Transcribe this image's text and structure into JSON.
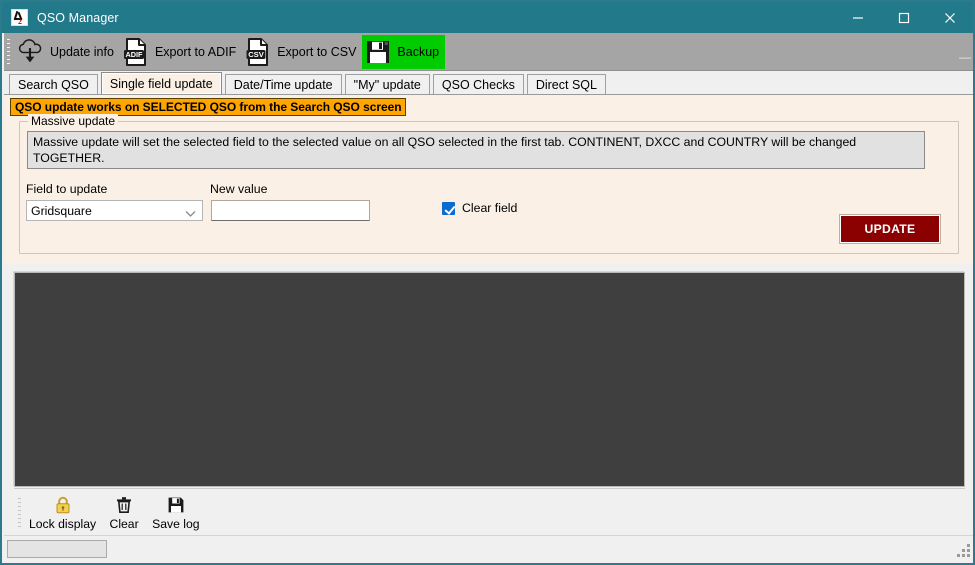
{
  "window": {
    "title": "QSO Manager",
    "app_icon": "qso-manager-icon",
    "controls": {
      "minimize": "minimize-icon",
      "maximize": "maximize-icon",
      "close": "close-icon"
    },
    "titlebar_color": "#21798a"
  },
  "toolbar": {
    "overflow_label": "—",
    "items": [
      {
        "label": "Update info",
        "icon": "cloud-download-icon",
        "highlight": false
      },
      {
        "label": "Export to ADIF",
        "icon": "file-adif-icon",
        "highlight": false
      },
      {
        "label": "Export to CSV",
        "icon": "file-csv-icon",
        "highlight": false
      },
      {
        "label": "Backup",
        "icon": "floppy-disk-icon",
        "highlight": true,
        "highlight_color": "#00cc00"
      }
    ]
  },
  "tabs": [
    {
      "label": "Search QSO",
      "selected": false
    },
    {
      "label": "Single field update",
      "selected": true
    },
    {
      "label": "Date/Time update",
      "selected": false
    },
    {
      "label": "\"My\" update",
      "selected": false
    },
    {
      "label": "QSO Checks",
      "selected": false
    },
    {
      "label": "Direct SQL",
      "selected": false
    }
  ],
  "page": {
    "banner": {
      "text": "QSO update works on SELECTED QSO from the Search QSO screen",
      "background": "#ffa500",
      "text_color": "#000000"
    },
    "group": {
      "legend": "Massive update",
      "description": "Massive update will set the selected field to the selected value on all QSO selected in the first tab. CONTINENT, DXCC and COUNTRY will be changed TOGETHER."
    },
    "field_to_update": {
      "label": "Field to update",
      "value": "Gridsquare",
      "chevron": "chevron-down-icon"
    },
    "new_value": {
      "label": "New value",
      "value": "",
      "placeholder": ""
    },
    "clear_field": {
      "label": "Clear field",
      "checked": true,
      "checked_color": "#0a6bd1"
    },
    "update_button": {
      "label": "UPDATE",
      "background": "#8b0000",
      "text_color": "#ffffff"
    }
  },
  "log": {
    "content": "",
    "background": "#3f3f3f"
  },
  "bottom_toolbar": {
    "items": [
      {
        "label": "Lock display",
        "icon": "padlock-icon"
      },
      {
        "label": "Clear",
        "icon": "trash-icon"
      },
      {
        "label": "Save log",
        "icon": "floppy-disk-icon"
      }
    ]
  },
  "statusbar": {
    "panel_text": "",
    "resize_grip": "resize-grip-icon"
  }
}
